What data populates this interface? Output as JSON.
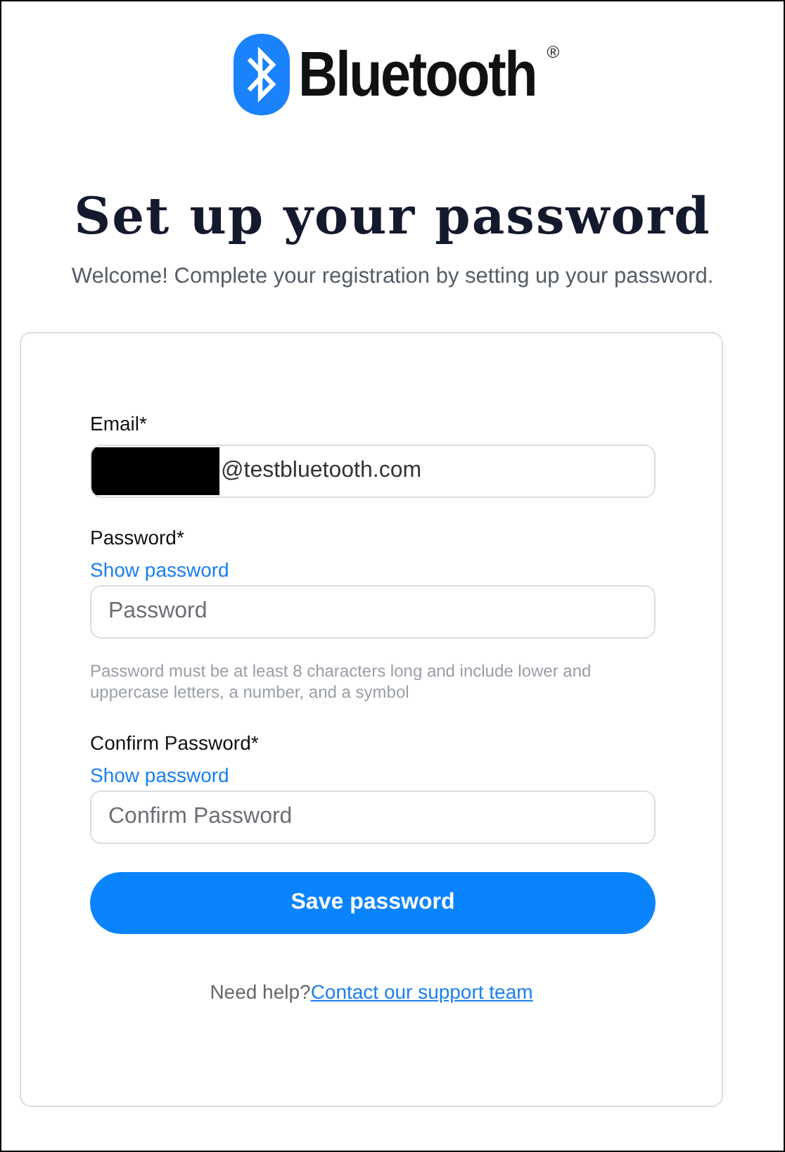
{
  "logo": {
    "wordmark": "Bluetooth",
    "registered": "®"
  },
  "title": "Set up your password",
  "subtitle": "Welcome! Complete your registration by setting up your password.",
  "form": {
    "fields": [
      {
        "kind": "email",
        "label": "Email*",
        "value": "@testbluetooth.com",
        "redacted": true
      },
      {
        "kind": "password",
        "label": "Password*",
        "toggle": "Show password",
        "placeholder": "Password",
        "hint": "Password must be at least 8 characters long and include lower and uppercase letters, a number, and a symbol"
      },
      {
        "kind": "password",
        "label": "Confirm Password*",
        "toggle": "Show password",
        "placeholder": "Confirm Password"
      }
    ],
    "submit": "Save password",
    "help": {
      "text": "Need help?",
      "link": "Contact our support team"
    }
  }
}
